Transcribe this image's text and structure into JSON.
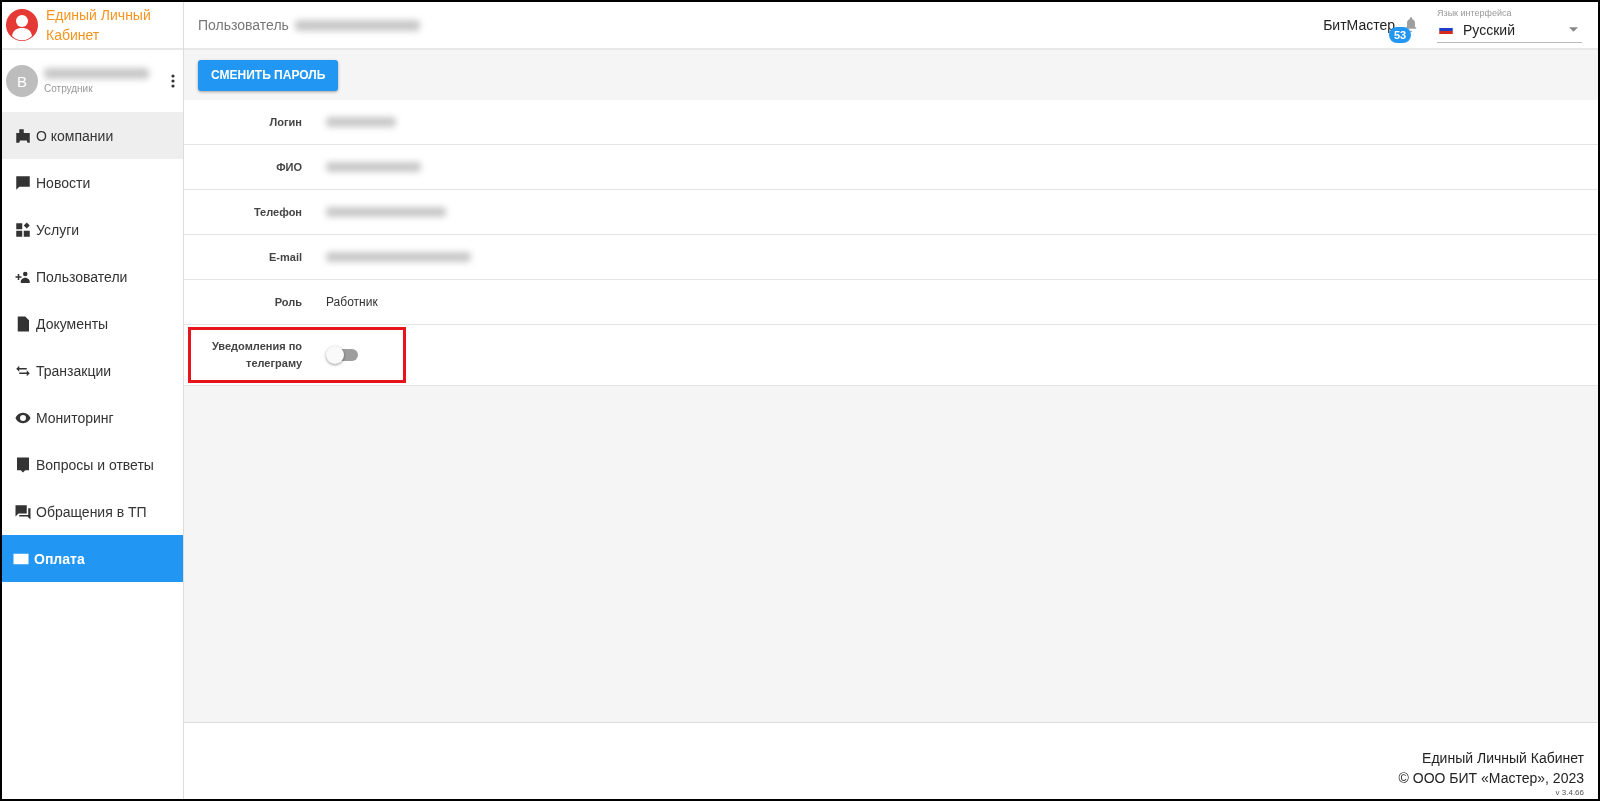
{
  "app": {
    "title": "Единый Личный Кабинет"
  },
  "topbar": {
    "user_label": "Пользователь",
    "user_redacted": true,
    "org": "БитМастер",
    "notifications_badge": "53",
    "language_label": "Язык интерфейса",
    "language": "Русский"
  },
  "profile": {
    "avatar_letter": "B",
    "name_redacted": true,
    "role": "Сотрудник"
  },
  "sidebar": {
    "items": [
      {
        "label": "О компании",
        "selected": false,
        "highlighted": true
      },
      {
        "label": "Новости",
        "selected": false,
        "highlighted": false
      },
      {
        "label": "Услуги",
        "selected": false,
        "highlighted": false
      },
      {
        "label": "Пользователи",
        "selected": false,
        "highlighted": false
      },
      {
        "label": "Документы",
        "selected": false,
        "highlighted": false
      },
      {
        "label": "Транзакции",
        "selected": false,
        "highlighted": false
      },
      {
        "label": "Мониторинг",
        "selected": false,
        "highlighted": false
      },
      {
        "label": "Вопросы и ответы",
        "selected": false,
        "highlighted": false
      },
      {
        "label": "Обращения в ТП",
        "selected": false,
        "highlighted": false
      },
      {
        "label": "Оплата",
        "selected": true,
        "highlighted": false
      }
    ]
  },
  "content": {
    "button": "СМЕНИТЬ ПАРОЛЬ",
    "fields": [
      {
        "kind": "text",
        "label": "Логин",
        "redacted": true
      },
      {
        "kind": "text",
        "label": "ФИО",
        "redacted": true
      },
      {
        "kind": "text",
        "label": "Телефон",
        "redacted": true
      },
      {
        "kind": "text",
        "label": "E-mail",
        "redacted": true
      },
      {
        "kind": "text",
        "label": "Роль",
        "redacted": false,
        "value": "Работник"
      },
      {
        "kind": "toggle",
        "label": "Уведомления по телеграму",
        "on": false,
        "highlighted": true
      }
    ]
  },
  "footer": {
    "title": "Единый Личный Кабинет",
    "copyright": "© ООО БИТ «Мастер», 2023",
    "version": "v 3.4.66"
  }
}
